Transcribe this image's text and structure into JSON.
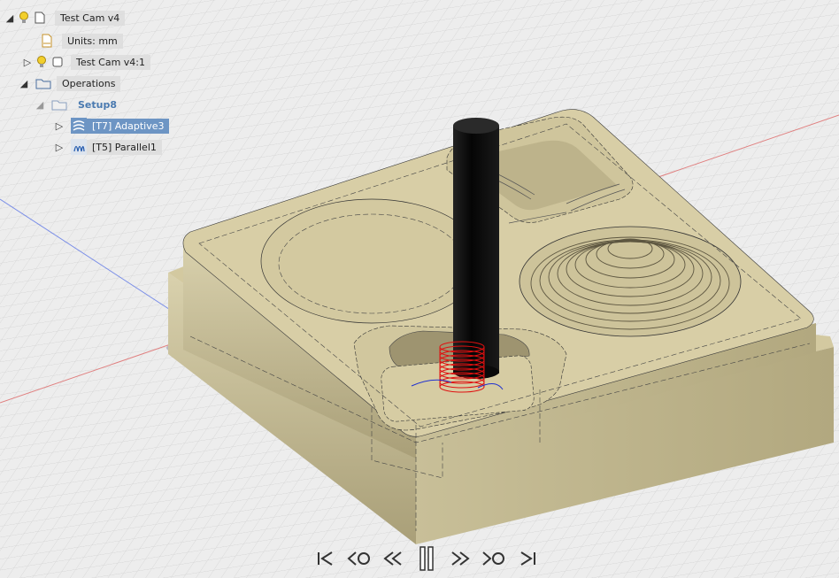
{
  "browser_tree": {
    "root": {
      "label": "Test Cam v4",
      "icon": "lightbulb-icon"
    },
    "units": {
      "label": "Units: mm",
      "icon": "document-icon"
    },
    "component": {
      "label": "Test Cam v4:1",
      "icon": "component-icon"
    },
    "operations": {
      "label": "Operations",
      "icon": "folder-icon"
    },
    "setup": {
      "label": "Setup8",
      "icon": "setup-folder-icon"
    },
    "ops": [
      {
        "label": "[T7] Adaptive3",
        "icon": "adaptive-clearing-icon",
        "selected": true
      },
      {
        "label": "[T5] Parallel1",
        "icon": "parallel-icon",
        "selected": false
      }
    ]
  },
  "playback": {
    "controls": [
      "go-to-start",
      "previous-operation",
      "step-back",
      "pause",
      "step-forward",
      "next-operation",
      "go-to-end"
    ]
  },
  "colors": {
    "stock": "#d6cca2",
    "stock_side": "#b8ad84",
    "tool": "#111111",
    "toolpath_red": "#e01010",
    "toolpath_blue": "#2030d0",
    "grid": "#d8d8d8",
    "background": "#ededed",
    "selection": "#6d95c4"
  }
}
